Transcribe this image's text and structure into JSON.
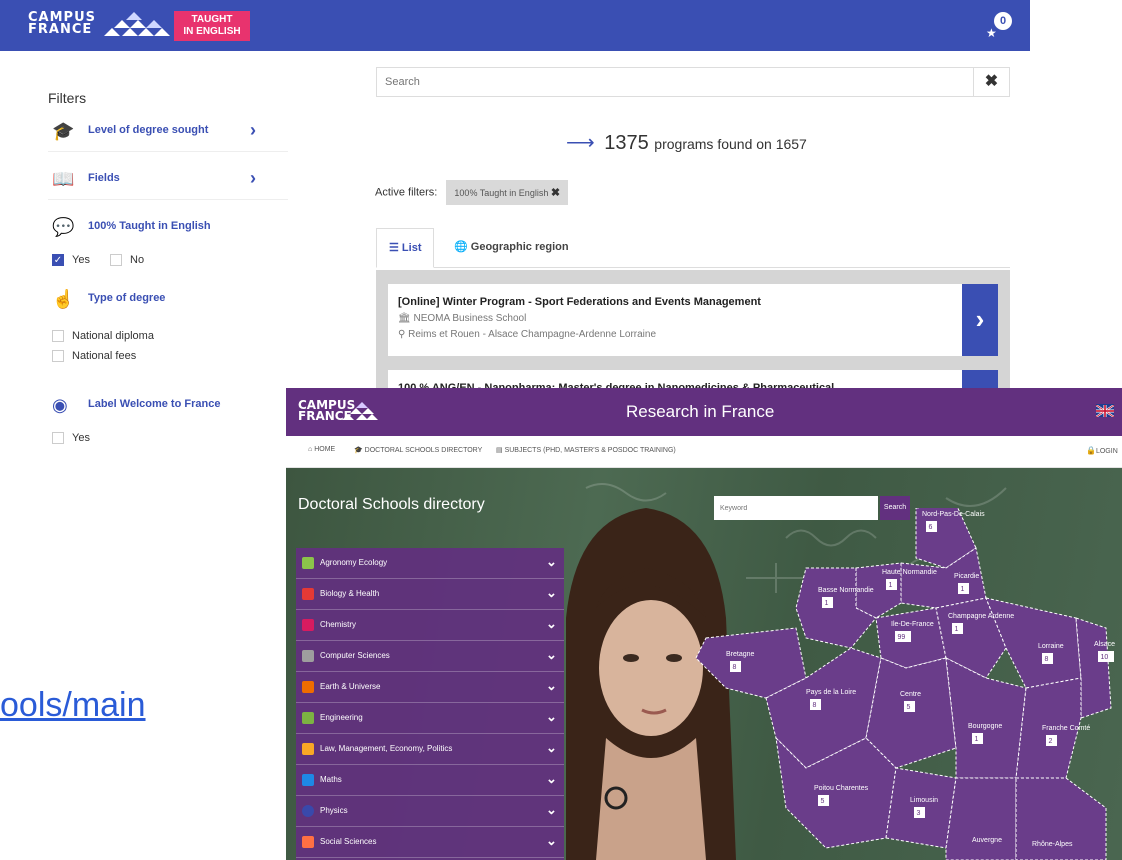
{
  "campus_france": {
    "logo_line1": "CAMPUS",
    "logo_line2": "FRANCE",
    "taught_badge_line1": "TAUGHT",
    "taught_badge_line2": "IN ENGLISH",
    "pin_count": "0",
    "filters_title": "Filters",
    "filters": [
      {
        "label": "Level of degree sought"
      },
      {
        "label": "Fields"
      },
      {
        "label": "100% Taught in English"
      },
      {
        "label": "Type of degree"
      },
      {
        "label": "Label Welcome to France"
      }
    ],
    "taught_yes": "Yes",
    "taught_no": "No",
    "degree_options": [
      "National diploma",
      "National fees"
    ],
    "welcome_yes": "Yes",
    "search_placeholder": "Search",
    "found_count": "1375",
    "found_text": "programs found on 1657",
    "active_filters_label": "Active filters:",
    "active_filter_chip": "100% Taught in English",
    "tabs": [
      {
        "label": "List"
      },
      {
        "label": "Geographic region"
      }
    ],
    "results": [
      {
        "title": "[Online] Winter Program - Sport Federations and Events Management",
        "school": "NEOMA Business School",
        "location": "Reims et Rouen - Alsace Champagne-Ardenne Lorraine"
      },
      {
        "title": "100 % ANG/EN - Nanopharma: Master's degree in Nanomedicines & Pharmaceutical",
        "school": "",
        "location": ""
      }
    ]
  },
  "url_fragment": "ools/main",
  "research_france": {
    "logo_line1": "CAMPUS",
    "logo_line2": "FRANCE",
    "title": "Research in France",
    "nav": [
      "HOME",
      "DOCTORAL SCHOOLS DIRECTORY",
      "SUBJECTS (PHD, MASTER'S & POSDOC TRAINING)"
    ],
    "login": "LOGIN",
    "directory_title": "Doctoral Schools directory",
    "search_placeholder": "Keyword",
    "search_button": "Search",
    "menu": [
      {
        "label": "Agronomy Ecology",
        "color": "#8bc34a"
      },
      {
        "label": "Biology & Health",
        "color": "#e53935"
      },
      {
        "label": "Chemistry",
        "color": "#d81b60"
      },
      {
        "label": "Computer Sciences",
        "color": "#9e9e9e"
      },
      {
        "label": "Earth & Universe",
        "color": "#ef6c00"
      },
      {
        "label": "Engineering",
        "color": "#7cb342"
      },
      {
        "label": "Law, Management, Economy, Politics",
        "color": "#f9a825"
      },
      {
        "label": "Maths",
        "color": "#1e88e5"
      },
      {
        "label": "Physics",
        "color": "#3949ab"
      },
      {
        "label": "Social Sciences",
        "color": "#ff7043"
      }
    ],
    "regions": [
      {
        "name": "Nord-Pas-De-Calais",
        "count": "6"
      },
      {
        "name": "Picardie",
        "count": "1"
      },
      {
        "name": "Haute Normandie",
        "count": "1"
      },
      {
        "name": "Basse Normandie",
        "count": "1"
      },
      {
        "name": "Bretagne",
        "count": "8"
      },
      {
        "name": "Ile-De-France",
        "count": "99"
      },
      {
        "name": "Champagne Ardenne",
        "count": "1"
      },
      {
        "name": "Lorraine",
        "count": "8"
      },
      {
        "name": "Alsace",
        "count": "10"
      },
      {
        "name": "Pays de la Loire",
        "count": "8"
      },
      {
        "name": "Centre",
        "count": "5"
      },
      {
        "name": "Bourgogne",
        "count": "1"
      },
      {
        "name": "Franche Comté",
        "count": "2"
      },
      {
        "name": "Poitou Charentes",
        "count": "5"
      },
      {
        "name": "Limousin",
        "count": "3"
      },
      {
        "name": "Auvergne",
        "count": ""
      },
      {
        "name": "Rhône-Alpes",
        "count": ""
      }
    ]
  }
}
